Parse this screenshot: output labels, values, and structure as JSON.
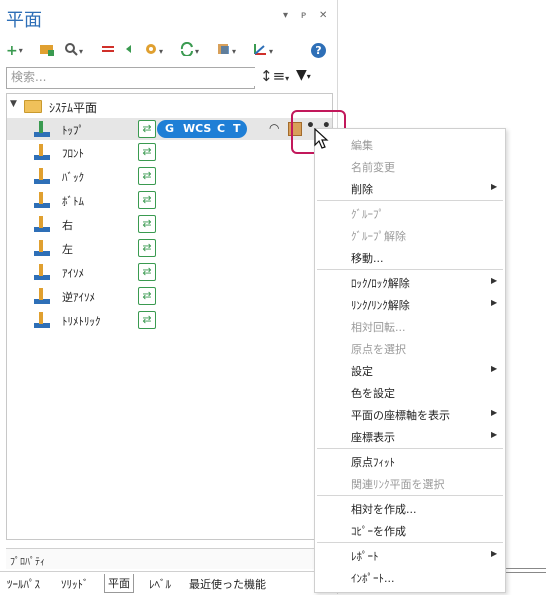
{
  "panel": {
    "title": "平面",
    "title_controls": [
      "▾",
      "ᴘ",
      "✕"
    ],
    "search_placeholder": "検索..."
  },
  "toolbar": {
    "add_icon": "+",
    "caret": "▾",
    "help_label": "?"
  },
  "tree": {
    "root_label": "ｼｽﾃﾑ平面",
    "root_expander": "▼",
    "items": [
      {
        "label": "ﾄｯﾌﾟ",
        "selected": true
      },
      {
        "label": "ﾌﾛﾝﾄ"
      },
      {
        "label": "ﾊﾞｯｸ"
      },
      {
        "label": "ﾎﾞﾄﾑ"
      },
      {
        "label": "右"
      },
      {
        "label": "左"
      },
      {
        "label": "ｱｲｿﾒ"
      },
      {
        "label": "逆ｱｲｿﾒ"
      },
      {
        "label": "ﾄﾘﾒﾄﾘｯｸ"
      }
    ],
    "badge": {
      "g": "G",
      "wcs": "WCS",
      "c": "C",
      "t": "T"
    },
    "more_label": "• •"
  },
  "properties_label": "ﾌﾟﾛﾊﾟﾃｨ",
  "tabs": [
    "ﾂｰﾙﾊﾟｽ",
    "ｿﾘｯﾄﾞ",
    "平面",
    "ﾚﾍﾞﾙ",
    "最近使った機能"
  ],
  "active_tab": "平面",
  "context_menu": {
    "items": [
      {
        "label": "編集",
        "disabled": true
      },
      {
        "label": "名前変更",
        "disabled": true
      },
      {
        "label": "削除",
        "submenu": true
      },
      {
        "label": "ｸﾞﾙｰﾌﾟ",
        "disabled": true
      },
      {
        "label": "ｸﾞﾙｰﾌﾟ解除",
        "disabled": true
      },
      {
        "label": "移動..."
      },
      {
        "label": "ﾛｯｸ/ﾛｯｸ解除",
        "submenu": true
      },
      {
        "label": "ﾘﾝｸ/ﾘﾝｸ解除",
        "submenu": true
      },
      {
        "label": "相対回転...",
        "disabled": true
      },
      {
        "label": "原点を選択",
        "disabled": true
      },
      {
        "label": "設定",
        "submenu": true
      },
      {
        "label": "色を設定"
      },
      {
        "label": "平面の座標軸を表示",
        "submenu": true
      },
      {
        "label": "座標表示",
        "submenu": true
      },
      {
        "label": "原点ﾌｨｯﾄ"
      },
      {
        "label": "関連ﾘﾝｸ平面を選択",
        "disabled": true
      },
      {
        "label": "相対を作成..."
      },
      {
        "label": "ｺﾋﾟｰを作成"
      },
      {
        "label": "ﾚﾎﾟｰﾄ",
        "submenu": true
      },
      {
        "label": "ｲﾝﾎﾟｰﾄ..."
      }
    ]
  },
  "colors": {
    "accent": "#2e6fb7",
    "badge": "#1f7fd6",
    "highlight": "#c2185b"
  }
}
